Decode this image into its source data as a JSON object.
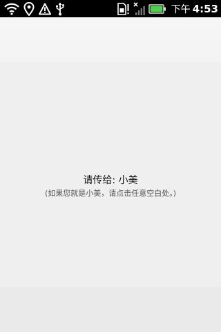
{
  "status_bar": {
    "left_icons": [
      "wifi-icon",
      "location-pin-icon",
      "warning-icon",
      "usb-icon"
    ],
    "right_icons": [
      "sim-card-alert-icon",
      "signal-off-icon",
      "battery-icon"
    ],
    "battery_color": "#4bd14b",
    "clock_ampm": "下午",
    "clock_time": "4:53"
  },
  "prompt": {
    "title": "请传给: 小美",
    "hint": "(如果您就是小美，请点击任意空白处。)"
  }
}
